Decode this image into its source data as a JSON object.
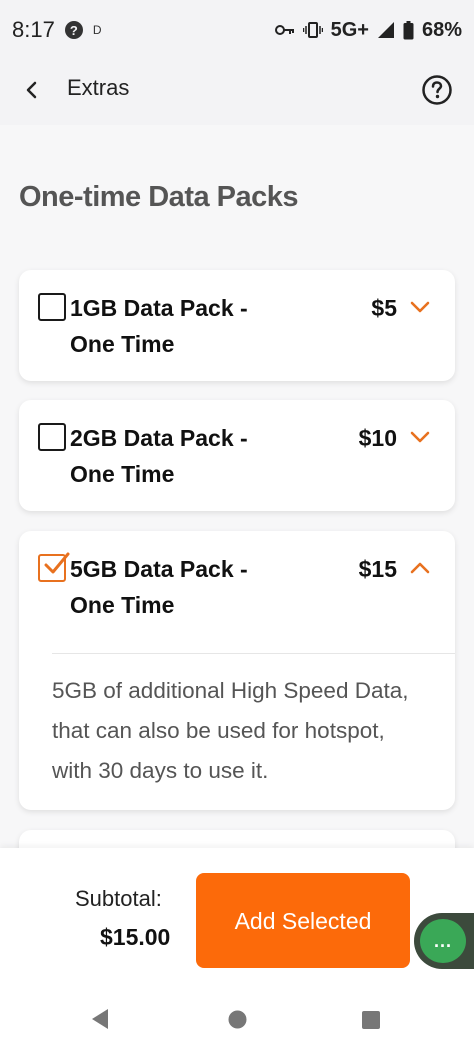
{
  "status_bar": {
    "time": "8:17",
    "notification_icon": "question-circle-icon",
    "d_indicator": "D",
    "network": "5G+",
    "battery": "68%",
    "icons": [
      "key-icon",
      "vibrate-icon",
      "signal-icon",
      "battery-icon"
    ]
  },
  "header": {
    "title": "Extras",
    "back_icon": "chevron-left-icon",
    "help_icon": "help-circle-icon"
  },
  "section": {
    "title": "One-time Data Packs"
  },
  "packs": [
    {
      "title": "1GB Data Pack - One Time",
      "price": "$5",
      "checked": false,
      "expanded": false
    },
    {
      "title": "2GB Data Pack - One Time",
      "price": "$10",
      "checked": false,
      "expanded": false
    },
    {
      "title": "5GB Data Pack - One Time",
      "price": "$15",
      "checked": true,
      "expanded": true,
      "description": "5GB of additional High Speed Data, that can also be used for hotspot, with 30 days to use it."
    }
  ],
  "footer": {
    "subtotal_label": "Subtotal:",
    "subtotal_value": "$15.00",
    "add_button_label": "Add Selected",
    "chat_icon": "chat-dots-icon",
    "chat_text": "..."
  },
  "colors": {
    "accent": "#fc6a0a",
    "chevron": "#e8711f",
    "chat_green": "#3aa857"
  }
}
